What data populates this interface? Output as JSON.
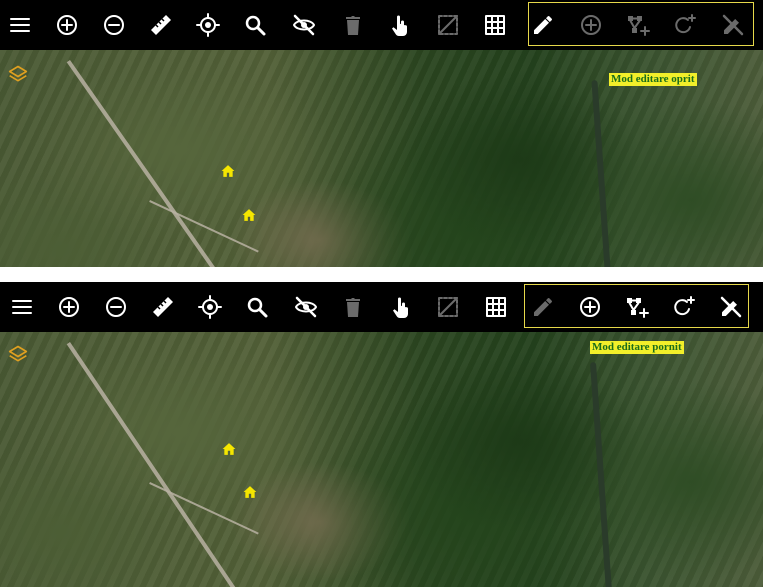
{
  "toolbar_icons": [
    "menu-icon",
    "zoom-in-icon",
    "zoom-out-icon",
    "measure-ruler-icon",
    "locate-target-icon",
    "search-icon",
    "hide-visibility-icon",
    "delete-trash-icon",
    "touch-select-icon",
    "box-select-icon",
    "table-grid-icon"
  ],
  "edit_icons": [
    "edit-pencil-icon",
    "add-point-icon",
    "add-vertex-icon",
    "rotate-add-icon",
    "edit-off-icon"
  ],
  "colors": {
    "toolbar_bg": "#000000",
    "icon_active": "#ffffff",
    "icon_disabled": "#6b6b6b",
    "edit_group_border": "#e6d84a",
    "label_bg": "#f2ef2a",
    "label_text": "#1a6e1a",
    "marker": "#f5e600",
    "layers_icon": "#e0a020"
  },
  "panels": {
    "top": {
      "mode_label": "Mod editare oprit",
      "edit_state": "off"
    },
    "bottom": {
      "mode_label": "Mod editare pornit",
      "edit_state": "on"
    }
  }
}
